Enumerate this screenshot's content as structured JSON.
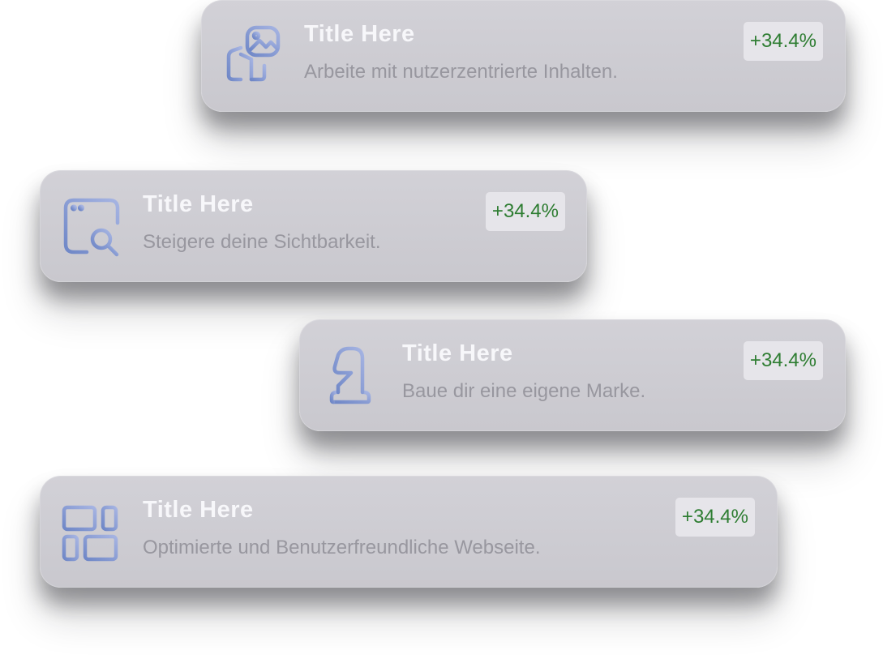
{
  "colors": {
    "card_background": "#cdccd2",
    "title": "#f7f7fa",
    "subtitle": "#98979f",
    "badge_background": "#e6e5ea",
    "badge_text": "#2e7d32",
    "icon_gradient_start": "#6f87c7",
    "icon_gradient_end": "#a6b4e2"
  },
  "cards": [
    {
      "icon": "image-map-icon",
      "title": "Title Here",
      "subtitle": "Arbeite mit nutzerzentrierte Inhalten.",
      "badge": "+34.4%"
    },
    {
      "icon": "browser-search-icon",
      "title": "Title Here",
      "subtitle": "Steigere deine Sichtbarkeit.",
      "badge": "+34.4%"
    },
    {
      "icon": "chess-knight-icon",
      "title": "Title Here",
      "subtitle": "Baue dir eine eigene Marke.",
      "badge": "+34.4%"
    },
    {
      "icon": "layout-grid-icon",
      "title": "Title Here",
      "subtitle": "Optimierte und Benutzerfreundliche Webseite.",
      "badge": "+34.4%"
    }
  ]
}
